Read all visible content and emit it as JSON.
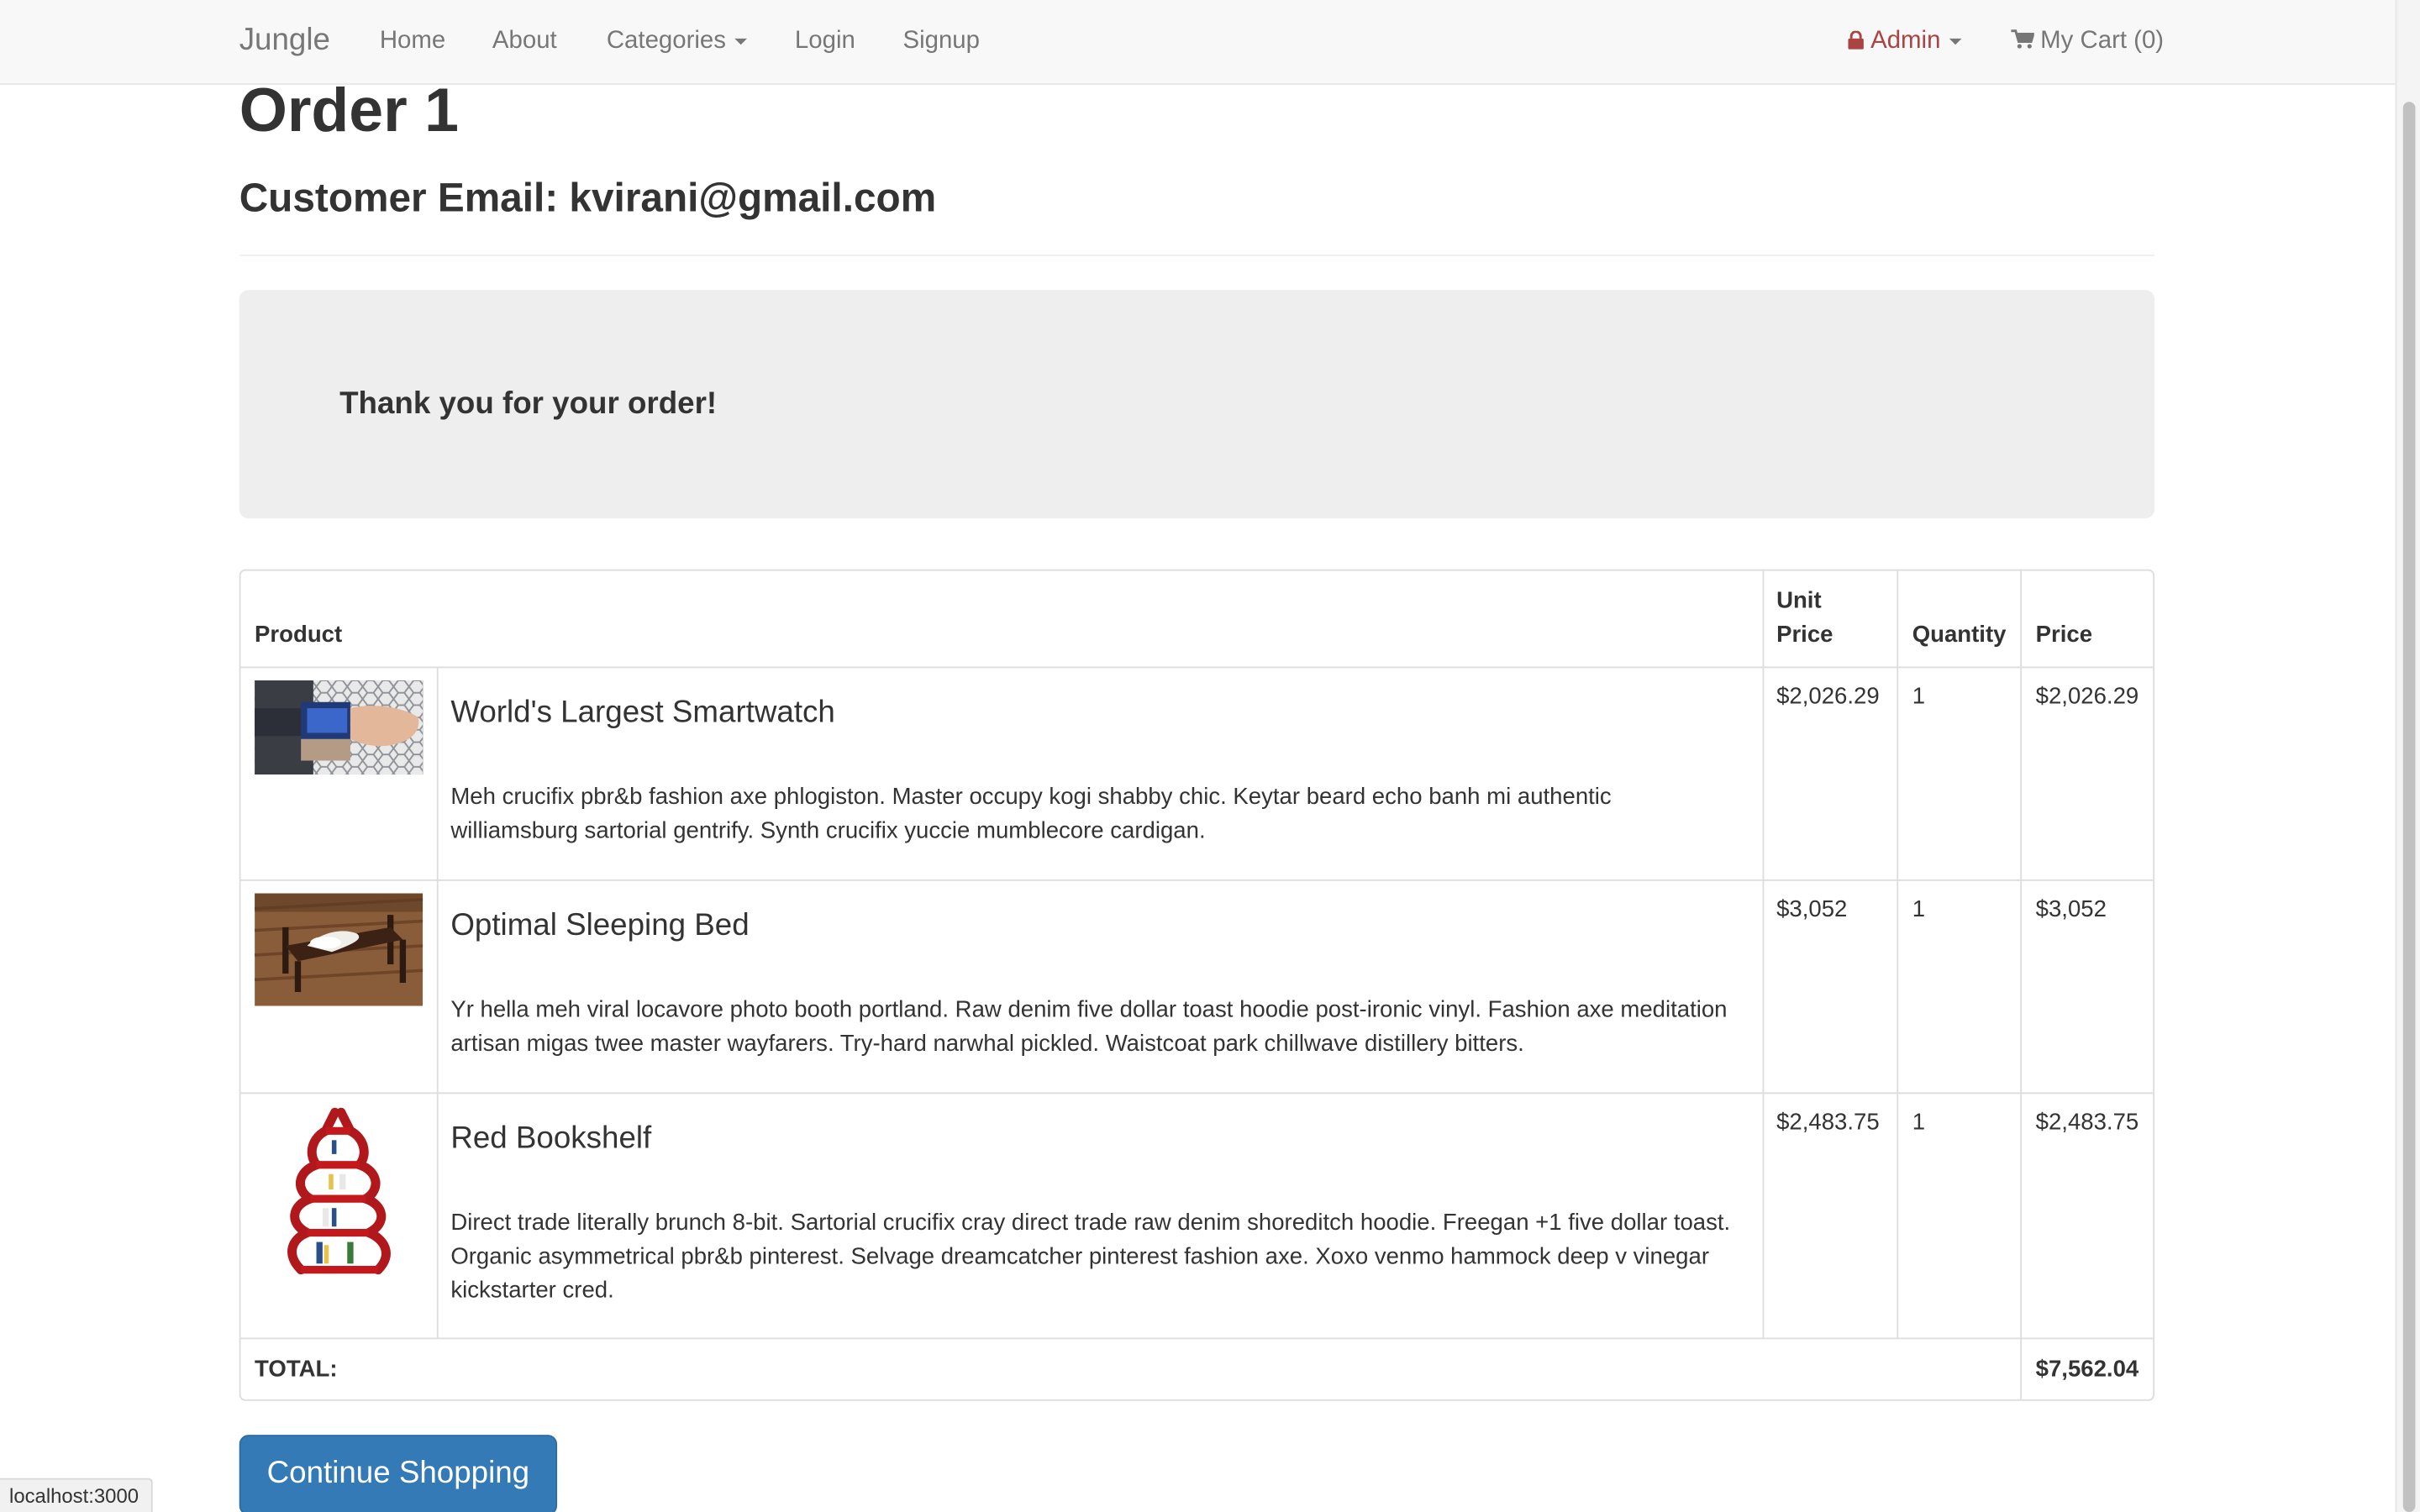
{
  "navbar": {
    "brand": "Jungle",
    "links": [
      "Home",
      "About",
      "Categories",
      "Login",
      "Signup"
    ],
    "admin_label": "Admin",
    "cart_label": "My Cart (0)",
    "admin_color": "#a94442"
  },
  "order": {
    "title": "Order 1",
    "customer_email": "Customer Email: kvirani@gmail.com",
    "thank_you": "Thank you for your order!"
  },
  "table": {
    "headers": {
      "product": "Product",
      "unit_price_1": "Unit",
      "unit_price_2": "Price",
      "quantity": "Quantity",
      "price": "Price"
    },
    "rows": [
      {
        "name": "World's Largest Smartwatch",
        "description": "Meh crucifix pbr&b fashion axe phlogiston. Master occupy kogi shabby chic. Keytar beard echo banh mi authentic williamsburg sartorial gentrify. Synth crucifix yuccie mumblecore cardigan.",
        "unit_price": "$2,026.29",
        "quantity": "1",
        "price": "$2,026.29"
      },
      {
        "name": "Optimal Sleeping Bed",
        "description": "Yr hella meh viral locavore photo booth portland. Raw denim five dollar toast hoodie post-ironic vinyl. Fashion axe meditation artisan migas twee master wayfarers. Try-hard narwhal pickled. Waistcoat park chillwave distillery bitters.",
        "unit_price": "$3,052",
        "quantity": "1",
        "price": "$3,052"
      },
      {
        "name": "Red Bookshelf",
        "description": "Direct trade literally brunch 8-bit. Sartorial crucifix cray direct trade raw denim shoreditch hoodie. Freegan +1 five dollar toast. Organic asymmetrical pbr&b pinterest. Selvage dreamcatcher pinterest fashion axe. Xoxo venmo hammock deep v vinegar kickstarter cred.",
        "unit_price": "$2,483.75",
        "quantity": "1",
        "price": "$2,483.75"
      }
    ],
    "total_label": "TOTAL:",
    "total_value": "$7,562.04"
  },
  "continue_button": "Continue Shopping",
  "status_bar": "localhost:3000",
  "colors": {
    "primary_button": "#337ab7",
    "jumbotron": "#eeeeee"
  }
}
